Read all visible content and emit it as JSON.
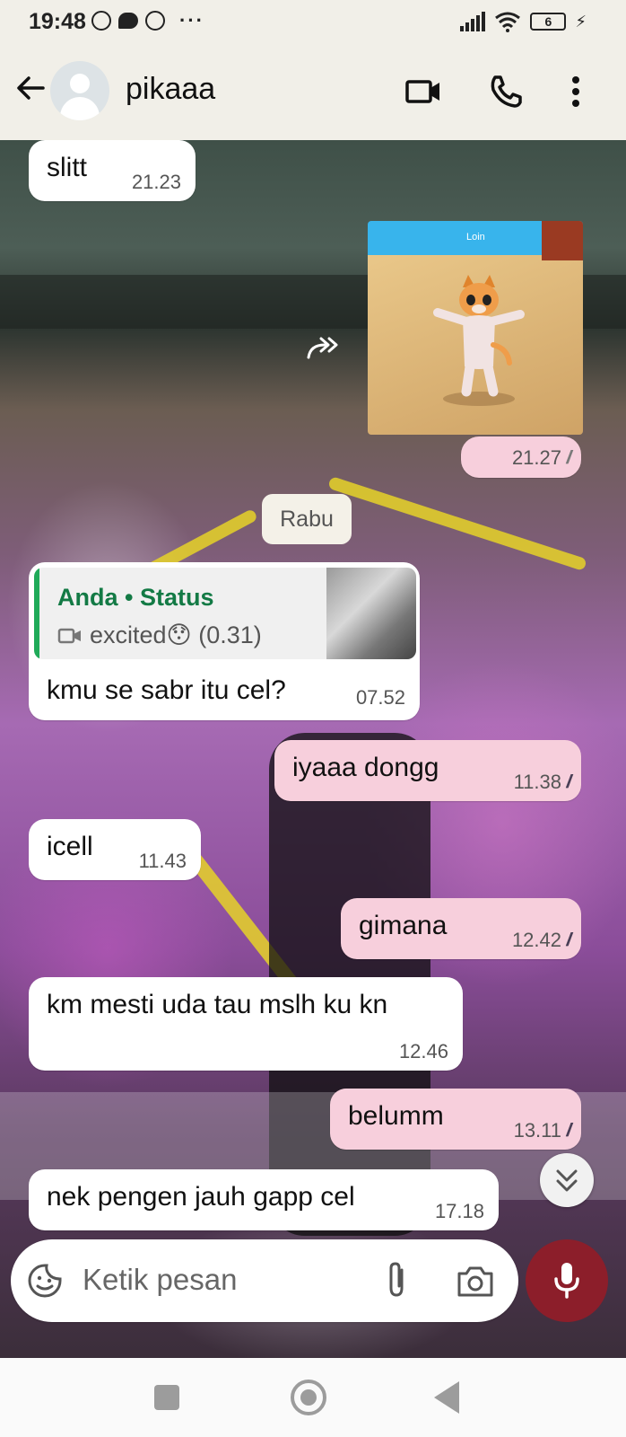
{
  "status_bar": {
    "time": "19:48",
    "dots": "···",
    "battery": "6"
  },
  "header": {
    "contact_name": "pikaaa"
  },
  "date_separator": "Rabu",
  "messages": [
    {
      "dir": "in",
      "text": "slitt",
      "time": "21.23"
    },
    {
      "dir": "out",
      "type": "image",
      "time": "21.27",
      "image_caption": "Loin",
      "read": false
    },
    {
      "dir": "in",
      "text": "kmu se sabr itu cel?",
      "time": "07.52",
      "reply": {
        "title": "Anda • Status",
        "desc": "excited😯 (0.31)"
      }
    },
    {
      "dir": "out",
      "text": "iyaaa dongg",
      "time": "11.38",
      "read": true
    },
    {
      "dir": "in",
      "text": "icell",
      "time": "11.43"
    },
    {
      "dir": "out",
      "text": "gimana",
      "time": "12.42",
      "read": true
    },
    {
      "dir": "in",
      "text": "km mesti uda tau mslh ku kn",
      "time": "12.46"
    },
    {
      "dir": "out",
      "text": "belumm",
      "time": "13.11",
      "read": true
    },
    {
      "dir": "in",
      "text": "nek pengen jauh gapp cel",
      "time": "17.18"
    }
  ],
  "composer": {
    "placeholder": "Ketik pesan"
  },
  "colors": {
    "outgoing_bubble": "#f7cfdc",
    "mic_button": "#8c1e2a",
    "reply_title": "#137a45"
  },
  "icons": [
    "whatsapp-icon",
    "chat-icon",
    "signal-icon",
    "wifi-icon",
    "battery-icon",
    "back-arrow-icon",
    "video-call-icon",
    "phone-icon",
    "more-icon",
    "forward-icon",
    "sticker-icon",
    "attach-icon",
    "camera-icon",
    "mic-icon",
    "scroll-down-icon"
  ]
}
